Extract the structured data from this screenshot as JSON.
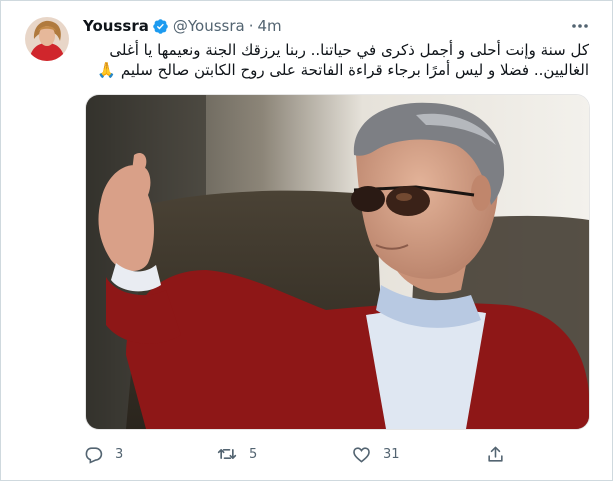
{
  "tweet": {
    "author_name": "Youssra",
    "handle": "@Youssra",
    "separator": "·",
    "time": "4m",
    "text_line1": "كل سنة وإنت أحلى و أجمل ذكرى في حياتنا.. ربنا يرزقك الجنة ونعيمها يا أغلى",
    "text_line2": "الغاليين.. فضلا و ليس أمرًا برجاء قراءة الفاتحة على روح الكابتن صالح سليم 🙏"
  },
  "actions": {
    "reply_count": "3",
    "retweet_count": "5",
    "like_count": "31"
  },
  "colors": {
    "verified": "#1d9bf0",
    "muted": "#536471",
    "border": "#cfd9de"
  },
  "icons": [
    "verified-badge-icon",
    "more-icon",
    "reply-icon",
    "retweet-icon",
    "like-icon",
    "share-icon"
  ]
}
